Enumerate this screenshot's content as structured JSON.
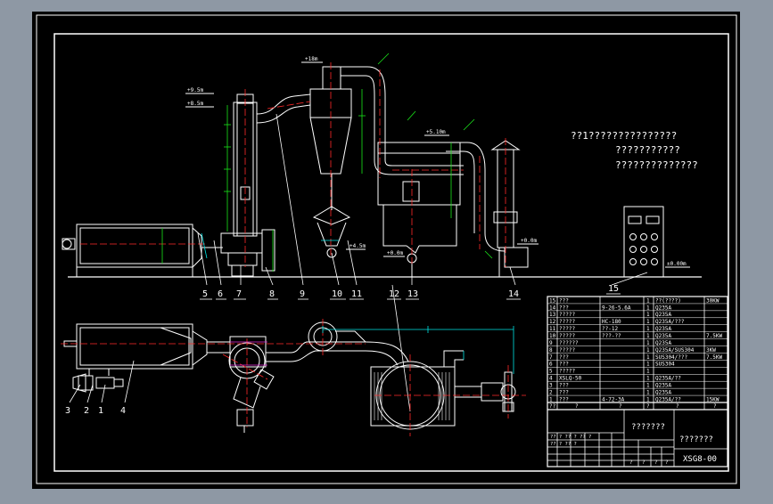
{
  "colors": {
    "background": "#8e98a4",
    "canvas": "#000000",
    "line": "#ffffff",
    "accent_red": "#ff2a2a",
    "accent_green": "#19e619",
    "accent_cyan": "#00e5e5",
    "accent_magenta": "#e02ad8"
  },
  "notes": {
    "line1": "??1???????????????",
    "line2": "???????????",
    "line3": "??????????????"
  },
  "elevations": {
    "top": "+18m",
    "left1": "+9.5m",
    "left2": "+8.5m",
    "mid": "+5.10m",
    "right": "+0.0m",
    "ground": "±0.00m",
    "hopper1": "+4.5m",
    "hopper2": "+0.0m"
  },
  "callouts": {
    "n1": "1",
    "n2": "2",
    "n3": "3",
    "n4": "4",
    "n5": "5",
    "n6": "6",
    "n7": "7",
    "n8": "8",
    "n9": "9",
    "n10": "10",
    "n11": "11",
    "n12": "12",
    "n13": "13",
    "n14": "14",
    "n15": "15"
  },
  "bom": {
    "rows": [
      {
        "no": "15",
        "name": "???",
        "spec": "",
        "qty": "1",
        "mat": "??(????)",
        "note": "30KW"
      },
      {
        "no": "14",
        "name": "???",
        "spec": "9-26-5.6A",
        "qty": "1",
        "mat": "Q235A",
        "note": ""
      },
      {
        "no": "13",
        "name": "?????",
        "spec": "",
        "qty": "1",
        "mat": "Q235A",
        "note": ""
      },
      {
        "no": "12",
        "name": "?????",
        "spec": "HC-180",
        "qty": "1",
        "mat": "Q235A/???",
        "note": ""
      },
      {
        "no": "11",
        "name": "?????",
        "spec": "??-12",
        "qty": "1",
        "mat": "Q235A",
        "note": ""
      },
      {
        "no": "10",
        "name": "?????",
        "spec": "???-??",
        "qty": "1",
        "mat": "Q235A",
        "note": "7.5KW"
      },
      {
        "no": "9",
        "name": "??????",
        "spec": "",
        "qty": "1",
        "mat": "Q235A",
        "note": ""
      },
      {
        "no": "8",
        "name": "?????",
        "spec": "",
        "qty": "1",
        "mat": "Q235A/SUS304",
        "note": "3KW"
      },
      {
        "no": "7",
        "name": "???",
        "spec": "",
        "qty": "1",
        "mat": "SUS304/???",
        "note": "7.5KW"
      },
      {
        "no": "6",
        "name": "???",
        "spec": "",
        "qty": "1",
        "mat": "SUS304",
        "note": ""
      },
      {
        "no": "5",
        "name": "?????",
        "spec": "",
        "qty": "1",
        "mat": "",
        "note": ""
      },
      {
        "no": "4",
        "name": "XSLQ-50",
        "spec": "",
        "qty": "1",
        "mat": "Q235A/??",
        "note": ""
      },
      {
        "no": "3",
        "name": "???",
        "spec": "",
        "qty": "1",
        "mat": "Q235A",
        "note": ""
      },
      {
        "no": "2",
        "name": "???",
        "spec": "",
        "qty": "1",
        "mat": "Q235A",
        "note": ""
      },
      {
        "no": "1",
        "name": "???",
        "spec": "4-72-3A",
        "qty": "1",
        "mat": "Q235A/??",
        "note": "15KW"
      }
    ],
    "header": {
      "no": "??",
      "name": "?",
      "spec": "?",
      "qty": "?",
      "mat": "?",
      "note": "?"
    }
  },
  "title_block": {
    "title": "???????",
    "company": "???????",
    "drawing_no": "XSG8-00",
    "row1": "?? ? ?? ? ?? ?",
    "row2": "?? ? ?? ?",
    "cells": [
      "?",
      "?",
      "?",
      "?"
    ]
  }
}
